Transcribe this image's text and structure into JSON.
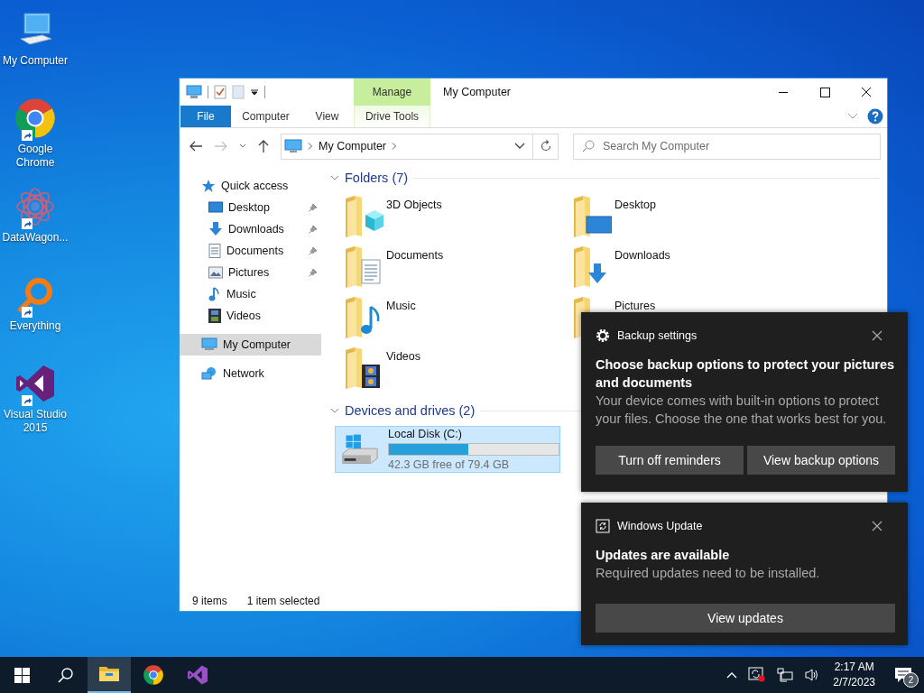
{
  "desktop_icons": [
    {
      "label": "My Computer",
      "kind": "computer",
      "shortcut": false
    },
    {
      "label": "Google Chrome",
      "kind": "chrome",
      "shortcut": true
    },
    {
      "label": "DataWagon...",
      "kind": "datawagon",
      "shortcut": true
    },
    {
      "label": "Everything",
      "kind": "everything",
      "shortcut": true
    },
    {
      "label": "Visual Studio 2015",
      "kind": "vs",
      "shortcut": true
    }
  ],
  "explorer": {
    "title": "My Computer",
    "contextual_group": "Manage",
    "ribbon_tabs": [
      {
        "label": "File",
        "kind": "file"
      },
      {
        "label": "Computer",
        "kind": "tab"
      },
      {
        "label": "View",
        "kind": "tab"
      },
      {
        "label": "Drive Tools",
        "kind": "contextual"
      }
    ],
    "address": "My Computer",
    "search_placeholder": "Search My Computer",
    "nav": [
      {
        "label": "Quick access",
        "kind": "star",
        "selected": false,
        "children": [
          {
            "label": "Desktop",
            "kind": "desktop",
            "pinned": true,
            "selected": false
          },
          {
            "label": "Downloads",
            "kind": "downloads",
            "pinned": true,
            "selected": false
          },
          {
            "label": "Documents",
            "kind": "documents",
            "pinned": true,
            "selected": false
          },
          {
            "label": "Pictures",
            "kind": "pictures",
            "pinned": true,
            "selected": false
          },
          {
            "label": "Music",
            "kind": "music",
            "pinned": false,
            "selected": false
          },
          {
            "label": "Videos",
            "kind": "videos",
            "pinned": false,
            "selected": false
          }
        ]
      },
      {
        "label": "My Computer",
        "kind": "computer",
        "selected": true
      },
      {
        "label": "Network",
        "kind": "network",
        "selected": false
      }
    ],
    "folders": {
      "heading": "Folders (7)",
      "items": [
        {
          "name": "3D Objects",
          "kind": "cube"
        },
        {
          "name": "Desktop",
          "kind": "desktop"
        },
        {
          "name": "Documents",
          "kind": "documents"
        },
        {
          "name": "Downloads",
          "kind": "downloads"
        },
        {
          "name": "Music",
          "kind": "music"
        },
        {
          "name": "Pictures",
          "kind": "pictures"
        },
        {
          "name": "Videos",
          "kind": "videos"
        }
      ]
    },
    "devices": {
      "heading": "Devices and drives (2)",
      "drives": [
        {
          "name": "Local Disk (C:)",
          "level": 0.47,
          "free": "42.3 GB free of 79.4 GB",
          "selected": true
        }
      ]
    },
    "status_bar": {
      "items": "9 items",
      "selection": "1 item selected"
    }
  },
  "toasts": [
    {
      "kind": "settings",
      "app": "Backup settings",
      "title": "Choose backup options to protect your pictures and documents",
      "body": "Your device comes with built-in options to protect your files. Choose the one that works best for you.",
      "buttons": [
        "Turn off reminders",
        "View backup options"
      ]
    },
    {
      "kind": "update",
      "app": "Windows Update",
      "title": "Updates are available",
      "body": "Required updates need to be installed.",
      "buttons": [
        "View updates"
      ]
    }
  ],
  "taskbar": {
    "apps": [
      {
        "kind": "explorer",
        "active": true
      },
      {
        "kind": "chrome",
        "active": false
      },
      {
        "kind": "vs",
        "active": false
      }
    ],
    "time": "2:17 AM",
    "date": "2/7/2023",
    "notifications": "2"
  }
}
